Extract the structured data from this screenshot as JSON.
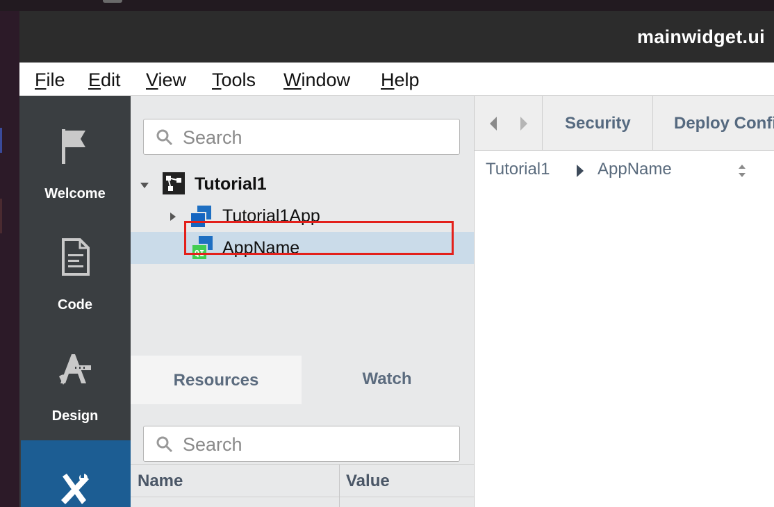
{
  "window": {
    "title": "mainwidget.ui"
  },
  "menubar": {
    "items": [
      {
        "mnemonic": "F",
        "rest": "ile"
      },
      {
        "mnemonic": "E",
        "rest": "dit"
      },
      {
        "mnemonic": "V",
        "rest": "iew"
      },
      {
        "mnemonic": "T",
        "rest": "ools"
      },
      {
        "mnemonic": "W",
        "rest": "indow"
      },
      {
        "mnemonic": "H",
        "rest": "elp"
      }
    ]
  },
  "modes": [
    {
      "label": "Welcome",
      "icon": "flag-icon"
    },
    {
      "label": "Code",
      "icon": "document-icon"
    },
    {
      "label": "Design",
      "icon": "design-icon"
    },
    {
      "label": "",
      "icon": "tools-icon"
    }
  ],
  "navigator": {
    "search_placeholder": "Search",
    "tree": [
      {
        "label": "Tutorial1",
        "icon": "project-icon"
      },
      {
        "label": "Tutorial1App",
        "icon": "component-icon"
      },
      {
        "label": "AppName",
        "icon": "qml-component-icon",
        "selected": true
      }
    ]
  },
  "bottom": {
    "tabs": [
      "Resources",
      "Watch"
    ],
    "search_placeholder": "Search",
    "columns": [
      "Name",
      "Value"
    ]
  },
  "editor": {
    "tabs": [
      "Security",
      "Deploy Confi"
    ],
    "breadcrumb": [
      "Tutorial1",
      "AppName"
    ]
  },
  "colors": {
    "accent": "#1c5d93",
    "selection": "#cadbe9",
    "highlight_box": "#e3201b",
    "sidebar": "#3a3e41",
    "titlebar": "#2c2c2c"
  }
}
